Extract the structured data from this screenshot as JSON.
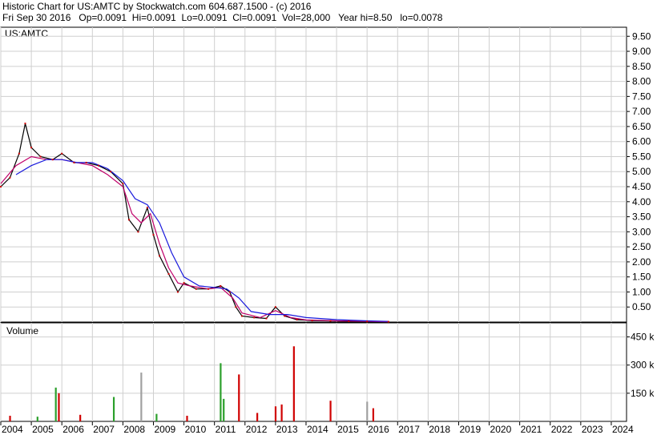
{
  "header": {
    "line1": "Historic Chart for US:AMTC by Stockwatch.com 604.687.1500 - (c) 2016",
    "line2": "Fri Sep 30 2016   Op=0.0091  Hi=0.0091  Lo=0.0091  Cl=0.0091  Vol=28,000   Year hi=8.50   lo=0.0078"
  },
  "colors": {
    "price": "#000000",
    "down_close": "#d00000",
    "ma_short": "#c0006a",
    "ma_long": "#1a1adc",
    "vol_up": "#2ca02c",
    "vol_down": "#d00000",
    "vol_flat": "#a0a0a0",
    "grid": "#cfcfcf"
  },
  "chart_data": [
    {
      "type": "line",
      "symbol": "US:AMTC",
      "y_ticks": [
        "0.50",
        "1.00",
        "1.50",
        "2.00",
        "2.50",
        "3.00",
        "3.50",
        "4.00",
        "4.50",
        "5.00",
        "5.50",
        "6.00",
        "6.50",
        "7.00",
        "7.50",
        "8.00",
        "8.50",
        "9.00",
        "9.50"
      ],
      "ylim": [
        0,
        9.8
      ],
      "grid": true,
      "price_points": [
        {
          "x": 2004.0,
          "y": 4.5
        },
        {
          "x": 2004.3,
          "y": 4.8
        },
        {
          "x": 2004.6,
          "y": 5.6
        },
        {
          "x": 2004.8,
          "y": 6.6
        },
        {
          "x": 2005.0,
          "y": 5.8
        },
        {
          "x": 2005.3,
          "y": 5.5
        },
        {
          "x": 2005.7,
          "y": 5.4
        },
        {
          "x": 2006.0,
          "y": 5.6
        },
        {
          "x": 2006.4,
          "y": 5.3
        },
        {
          "x": 2006.8,
          "y": 5.3
        },
        {
          "x": 2007.2,
          "y": 5.2
        },
        {
          "x": 2007.6,
          "y": 5.0
        },
        {
          "x": 2008.0,
          "y": 4.6
        },
        {
          "x": 2008.2,
          "y": 3.4
        },
        {
          "x": 2008.5,
          "y": 3.0
        },
        {
          "x": 2008.8,
          "y": 3.8
        },
        {
          "x": 2009.0,
          "y": 2.9
        },
        {
          "x": 2009.2,
          "y": 2.2
        },
        {
          "x": 2009.5,
          "y": 1.6
        },
        {
          "x": 2009.8,
          "y": 1.0
        },
        {
          "x": 2010.0,
          "y": 1.3
        },
        {
          "x": 2010.4,
          "y": 1.1
        },
        {
          "x": 2010.8,
          "y": 1.1
        },
        {
          "x": 2011.2,
          "y": 1.2
        },
        {
          "x": 2011.5,
          "y": 1.0
        },
        {
          "x": 2011.7,
          "y": 0.5
        },
        {
          "x": 2011.9,
          "y": 0.2
        },
        {
          "x": 2012.3,
          "y": 0.15
        },
        {
          "x": 2012.7,
          "y": 0.12
        },
        {
          "x": 2013.0,
          "y": 0.5
        },
        {
          "x": 2013.3,
          "y": 0.2
        },
        {
          "x": 2013.7,
          "y": 0.08
        },
        {
          "x": 2014.2,
          "y": 0.05
        },
        {
          "x": 2014.8,
          "y": 0.04
        },
        {
          "x": 2015.4,
          "y": 0.03
        },
        {
          "x": 2016.0,
          "y": 0.02
        },
        {
          "x": 2016.7,
          "y": 0.01
        }
      ],
      "ma_short_points": [
        {
          "x": 2004.0,
          "y": 4.6
        },
        {
          "x": 2004.5,
          "y": 5.2
        },
        {
          "x": 2005.0,
          "y": 5.5
        },
        {
          "x": 2005.5,
          "y": 5.4
        },
        {
          "x": 2006.0,
          "y": 5.4
        },
        {
          "x": 2006.5,
          "y": 5.3
        },
        {
          "x": 2007.0,
          "y": 5.2
        },
        {
          "x": 2007.5,
          "y": 4.9
        },
        {
          "x": 2008.0,
          "y": 4.5
        },
        {
          "x": 2008.3,
          "y": 3.6
        },
        {
          "x": 2008.6,
          "y": 3.3
        },
        {
          "x": 2008.9,
          "y": 3.6
        },
        {
          "x": 2009.2,
          "y": 2.6
        },
        {
          "x": 2009.5,
          "y": 1.8
        },
        {
          "x": 2009.8,
          "y": 1.3
        },
        {
          "x": 2010.2,
          "y": 1.2
        },
        {
          "x": 2010.8,
          "y": 1.1
        },
        {
          "x": 2011.2,
          "y": 1.15
        },
        {
          "x": 2011.6,
          "y": 0.8
        },
        {
          "x": 2011.9,
          "y": 0.3
        },
        {
          "x": 2012.5,
          "y": 0.15
        },
        {
          "x": 2013.0,
          "y": 0.38
        },
        {
          "x": 2013.5,
          "y": 0.15
        },
        {
          "x": 2014.0,
          "y": 0.07
        },
        {
          "x": 2015.0,
          "y": 0.04
        },
        {
          "x": 2016.0,
          "y": 0.02
        },
        {
          "x": 2016.7,
          "y": 0.01
        }
      ],
      "ma_long_points": [
        {
          "x": 2004.5,
          "y": 4.9
        },
        {
          "x": 2005.0,
          "y": 5.2
        },
        {
          "x": 2005.5,
          "y": 5.4
        },
        {
          "x": 2006.0,
          "y": 5.4
        },
        {
          "x": 2006.5,
          "y": 5.3
        },
        {
          "x": 2007.0,
          "y": 5.3
        },
        {
          "x": 2007.5,
          "y": 5.1
        },
        {
          "x": 2008.0,
          "y": 4.7
        },
        {
          "x": 2008.4,
          "y": 4.1
        },
        {
          "x": 2008.8,
          "y": 3.9
        },
        {
          "x": 2009.2,
          "y": 3.3
        },
        {
          "x": 2009.6,
          "y": 2.3
        },
        {
          "x": 2010.0,
          "y": 1.5
        },
        {
          "x": 2010.5,
          "y": 1.2
        },
        {
          "x": 2011.0,
          "y": 1.15
        },
        {
          "x": 2011.4,
          "y": 1.1
        },
        {
          "x": 2011.8,
          "y": 0.8
        },
        {
          "x": 2012.2,
          "y": 0.35
        },
        {
          "x": 2012.8,
          "y": 0.25
        },
        {
          "x": 2013.4,
          "y": 0.25
        },
        {
          "x": 2014.0,
          "y": 0.15
        },
        {
          "x": 2015.0,
          "y": 0.08
        },
        {
          "x": 2016.0,
          "y": 0.04
        },
        {
          "x": 2016.7,
          "y": 0.02
        }
      ]
    },
    {
      "type": "bar",
      "title": "Volume",
      "y_ticks": [
        "150 k",
        "300 k",
        "450 k"
      ],
      "ylim": [
        0,
        525000
      ],
      "grid": true,
      "bars": [
        {
          "x": 2005.8,
          "value": 180000,
          "dir": "up"
        },
        {
          "x": 2005.9,
          "value": 150000,
          "dir": "down"
        },
        {
          "x": 2007.7,
          "value": 130000,
          "dir": "up"
        },
        {
          "x": 2008.6,
          "value": 260000,
          "dir": "flat"
        },
        {
          "x": 2011.2,
          "value": 310000,
          "dir": "up"
        },
        {
          "x": 2011.3,
          "value": 120000,
          "dir": "up"
        },
        {
          "x": 2011.8,
          "value": 250000,
          "dir": "down"
        },
        {
          "x": 2013.0,
          "value": 80000,
          "dir": "down"
        },
        {
          "x": 2013.6,
          "value": 400000,
          "dir": "down"
        },
        {
          "x": 2014.8,
          "value": 110000,
          "dir": "down"
        },
        {
          "x": 2016.0,
          "value": 105000,
          "dir": "flat"
        },
        {
          "x": 2016.2,
          "value": 70000,
          "dir": "down"
        },
        {
          "x": 2004.3,
          "value": 30000,
          "dir": "down"
        },
        {
          "x": 2005.2,
          "value": 25000,
          "dir": "up"
        },
        {
          "x": 2006.6,
          "value": 35000,
          "dir": "down"
        },
        {
          "x": 2009.1,
          "value": 40000,
          "dir": "up"
        },
        {
          "x": 2010.1,
          "value": 30000,
          "dir": "down"
        },
        {
          "x": 2012.4,
          "value": 45000,
          "dir": "down"
        },
        {
          "x": 2013.2,
          "value": 90000,
          "dir": "down"
        }
      ]
    }
  ],
  "x_ticks": [
    "2004",
    "2005",
    "2006",
    "2007",
    "2008",
    "2009",
    "2010",
    "2011",
    "2012",
    "2013",
    "2014",
    "2015",
    "2016",
    "2017",
    "2018",
    "2019",
    "2020",
    "2021",
    "2022",
    "2023",
    "2024"
  ],
  "x_tick_values": [
    2004,
    2005,
    2006,
    2007,
    2008,
    2009,
    2010,
    2011,
    2012,
    2013,
    2014,
    2015,
    2016,
    2017,
    2018,
    2019,
    2020,
    2021,
    2022,
    2023,
    2024
  ]
}
